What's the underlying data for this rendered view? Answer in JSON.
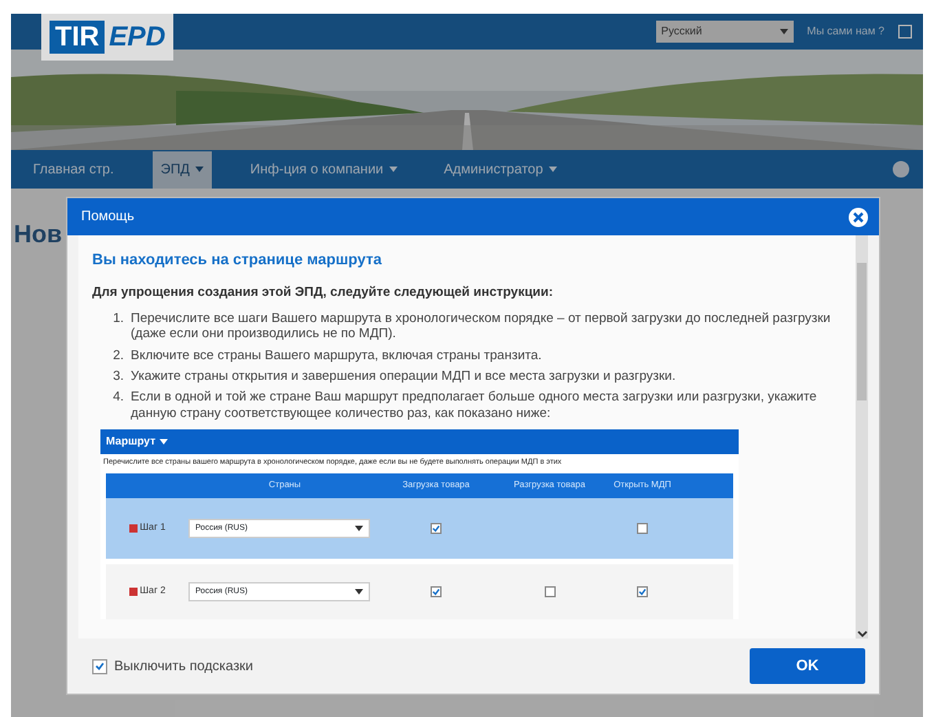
{
  "header": {
    "logo": [
      "TIR",
      "EPD"
    ],
    "language": "Русский",
    "user": "Мы сами нам ?"
  },
  "nav": [
    {
      "label": "Главная стр.",
      "dropdown": false,
      "selected": false
    },
    {
      "label": "ЭПД",
      "dropdown": true,
      "selected": true
    },
    {
      "label": "Инф-ция о компании",
      "dropdown": true,
      "selected": false
    },
    {
      "label": "Администратор",
      "dropdown": true,
      "selected": false
    }
  ],
  "page": {
    "title": "Нов"
  },
  "modal": {
    "title": "Помощь",
    "heading": "Вы находитесь на странице маршрута",
    "intro": "Для упрощения создания этой ЭПД, следуйте следующей инструкции:",
    "steps": [
      {
        "number": "1.",
        "text": "Перечислите все шаги Вашего маршрута в хронологическом порядке – от первой загрузки до последней разгрузки (даже если они производились не по МДП)."
      },
      {
        "number": "2.",
        "text": "Включите все страны Вашего маршрута, включая страны транзита."
      },
      {
        "number": "3.",
        "text": "Укажите страны открытия и завершения операции МДП и все места загрузки и разгрузки."
      },
      {
        "number": "4.",
        "text": "Если в одной и той же стране Ваш маршрут предполагает больше одного места загрузки или разгрузки, укажите данную страну соответствующее количество раз, как показано ниже:"
      }
    ],
    "example": {
      "title": "Маршрут",
      "description": "Перечислите все страны вашего маршрута в хронологическом порядке, даже если вы не будете выполнять операции МДП в этих",
      "columns": [
        "Страны",
        "Загрузка товара",
        "Разгрузка товара",
        "Открыть МДП"
      ],
      "rows": [
        {
          "label": "Шаг 1",
          "country": "Россия (RUS)",
          "selected": true,
          "load": {
            "checked": true
          },
          "open": {
            "checked": false
          }
        },
        {
          "label": "Шаг 2",
          "country": "Россия (RUS)",
          "selected": false,
          "load": {
            "checked": true
          },
          "unload": {
            "checked": false
          },
          "open": {
            "checked": true
          }
        }
      ]
    },
    "disable_hints": {
      "label": "Выключить подсказки",
      "checked": true
    },
    "ok": "OK"
  }
}
